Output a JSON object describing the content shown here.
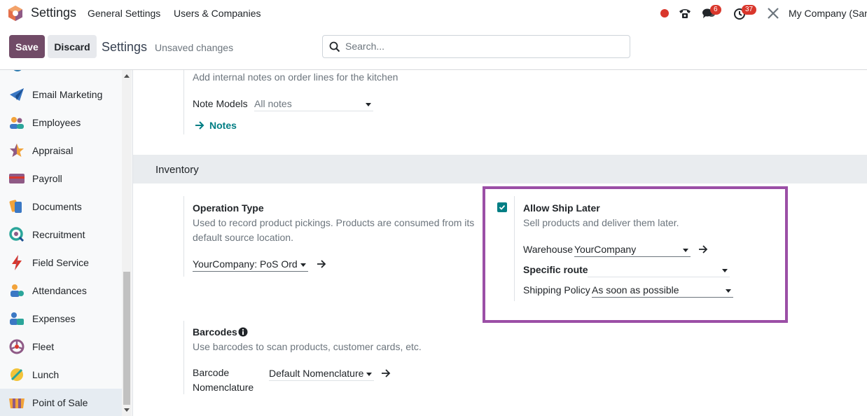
{
  "navbar": {
    "app_title": "Settings",
    "menus": [
      "General Settings",
      "Users & Companies"
    ],
    "messages_badge": "6",
    "activities_badge": "37",
    "company": "My Company (San"
  },
  "control_panel": {
    "save_label": "Save",
    "discard_label": "Discard",
    "title": "Settings",
    "status": "Unsaved changes",
    "search_placeholder": "Search..."
  },
  "sidebar": {
    "items": [
      {
        "label": "Email Marketing",
        "icon": "email-marketing-icon"
      },
      {
        "label": "Employees",
        "icon": "employees-icon"
      },
      {
        "label": "Appraisal",
        "icon": "appraisal-icon"
      },
      {
        "label": "Payroll",
        "icon": "payroll-icon"
      },
      {
        "label": "Documents",
        "icon": "documents-icon"
      },
      {
        "label": "Recruitment",
        "icon": "recruitment-icon"
      },
      {
        "label": "Field Service",
        "icon": "field-service-icon"
      },
      {
        "label": "Attendances",
        "icon": "attendances-icon"
      },
      {
        "label": "Expenses",
        "icon": "expenses-icon"
      },
      {
        "label": "Fleet",
        "icon": "fleet-icon"
      },
      {
        "label": "Lunch",
        "icon": "lunch-icon"
      },
      {
        "label": "Point of Sale",
        "icon": "point-of-sale-icon",
        "active": true
      }
    ]
  },
  "kitchen_notes": {
    "desc": "Add internal notes on order lines for the kitchen",
    "note_models_label": "Note Models",
    "note_models_value": "All notes",
    "notes_link": "Notes"
  },
  "inventory": {
    "section_title": "Inventory",
    "operation_type": {
      "title": "Operation Type",
      "desc_line1": "Used to record product pickings. Products are consumed from its",
      "desc_line2": "default source location.",
      "value": "YourCompany: PoS Orders"
    },
    "ship_later": {
      "title": "Allow Ship Later",
      "desc": "Sell products and deliver them later.",
      "checked": true,
      "warehouse_label": "Warehouse",
      "warehouse_value": "YourCompany",
      "route_label": "Specific route",
      "route_value": "",
      "policy_label": "Shipping Policy",
      "policy_value": "As soon as possible"
    },
    "barcodes": {
      "title": "Barcodes",
      "desc": "Use barcodes to scan products, customer cards, etc.",
      "nomenclature_label_1": "Barcode",
      "nomenclature_label_2": "Nomenclature",
      "nomenclature_value": "Default Nomenclature"
    }
  },
  "colors": {
    "brand": "#714b67",
    "link": "#017e84",
    "highlight": "#9b4fa6",
    "badge": "#d9372c"
  }
}
